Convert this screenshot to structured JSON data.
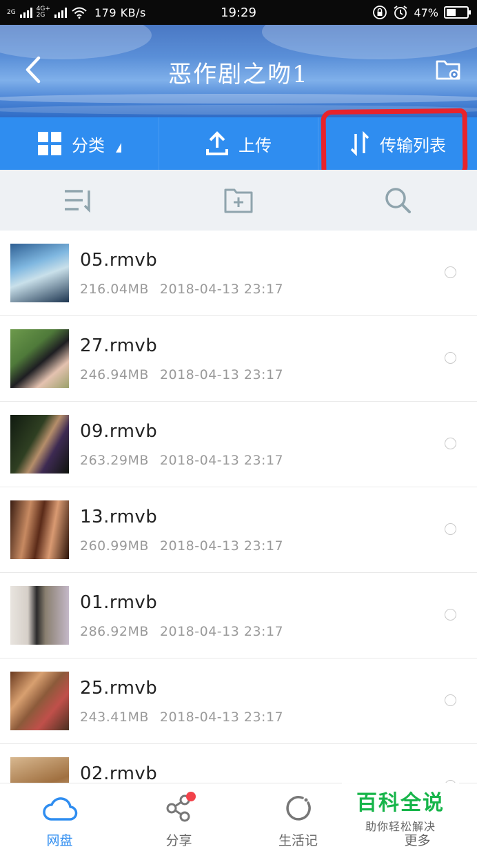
{
  "status_bar": {
    "network_1": "2G",
    "network_2_top": "4G+",
    "network_2_bottom": "2G",
    "speed": "179 KB/s",
    "time": "19:29",
    "battery": "47%",
    "battery_level": 0.47
  },
  "header": {
    "title": "恶作剧之吻1",
    "back_icon": "chevron-left-icon",
    "folder_settings_icon": "folder-settings-icon"
  },
  "tabs": [
    {
      "label": "分类",
      "icon": "grid-icon"
    },
    {
      "label": "上传",
      "icon": "upload-icon"
    },
    {
      "label": "传输列表",
      "icon": "transfer-icon"
    }
  ],
  "toolbar": {
    "sort_icon": "sort-icon",
    "new_folder_icon": "folder-add-icon",
    "search_icon": "search-icon"
  },
  "files": [
    {
      "name": "05.rmvb",
      "size": "216.04MB",
      "date": "2018-04-13 23:17"
    },
    {
      "name": "27.rmvb",
      "size": "246.94MB",
      "date": "2018-04-13 23:17"
    },
    {
      "name": "09.rmvb",
      "size": "263.29MB",
      "date": "2018-04-13 23:17"
    },
    {
      "name": "13.rmvb",
      "size": "260.99MB",
      "date": "2018-04-13 23:17"
    },
    {
      "name": "01.rmvb",
      "size": "286.92MB",
      "date": "2018-04-13 23:17"
    },
    {
      "name": "25.rmvb",
      "size": "243.41MB",
      "date": "2018-04-13 23:17"
    },
    {
      "name": "02.rmvb",
      "size": "",
      "date": ""
    }
  ],
  "bottom_nav": [
    {
      "label": "网盘",
      "icon": "cloud-icon",
      "active": true
    },
    {
      "label": "分享",
      "icon": "share-icon",
      "active": false
    },
    {
      "label": "生活记",
      "icon": "refresh-icon",
      "active": false
    },
    {
      "label": "更多",
      "icon": "more-icon",
      "active": false
    }
  ],
  "watermark": {
    "main": "百科全说",
    "sub": "助你轻松解决"
  },
  "colors": {
    "accent": "#2f8df0",
    "highlight": "#e8232b",
    "watermark_green": "#17b54a"
  }
}
